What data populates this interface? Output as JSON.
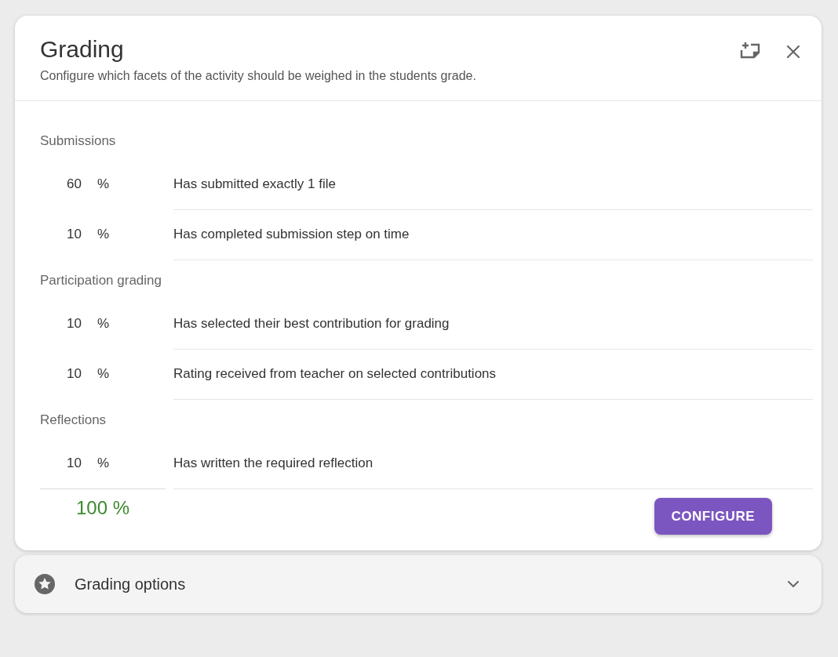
{
  "dialog": {
    "title": "Grading",
    "subtitle": "Configure which facets of the activity should be weighed in the students grade."
  },
  "sections": [
    {
      "title": "Submissions",
      "rows": [
        {
          "value": "60",
          "unit": "%",
          "label": "Has submitted exactly 1 file"
        },
        {
          "value": "10",
          "unit": "%",
          "label": "Has completed submission step on time"
        }
      ]
    },
    {
      "title": "Participation grading",
      "rows": [
        {
          "value": "10",
          "unit": "%",
          "label": "Has selected their best contribution for grading"
        },
        {
          "value": "10",
          "unit": "%",
          "label": "Rating received from teacher on selected contributions"
        }
      ]
    },
    {
      "title": "Reflections",
      "rows": [
        {
          "value": "10",
          "unit": "%",
          "label": "Has written the required reflection"
        }
      ]
    }
  ],
  "total": "100 %",
  "configure_button": "CONFIGURE",
  "options_panel": {
    "title": "Grading options",
    "expanded": false
  }
}
